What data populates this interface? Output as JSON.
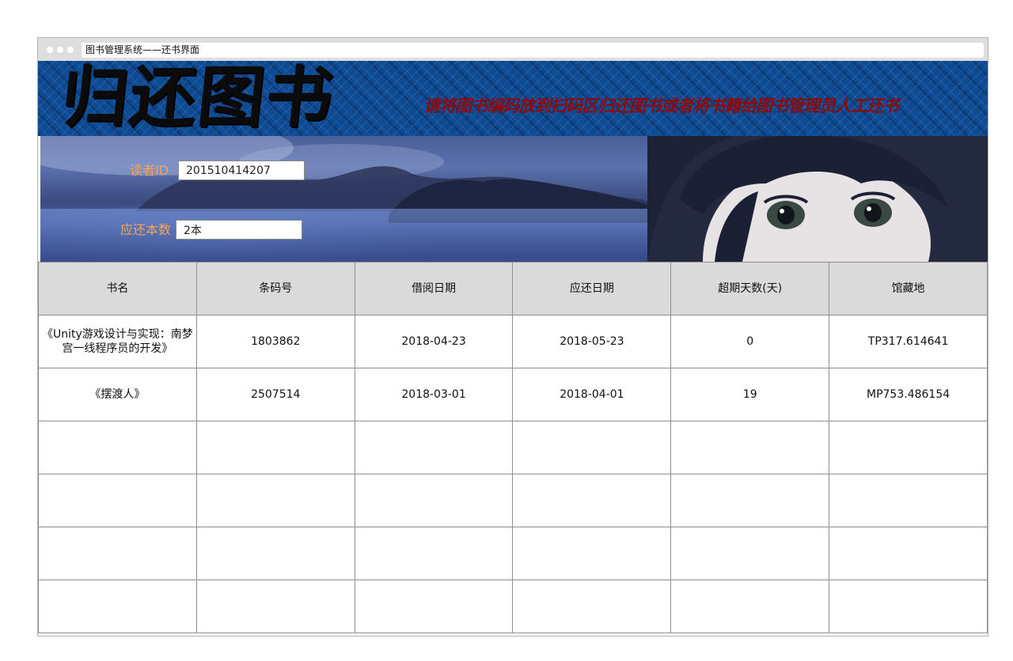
{
  "window": {
    "title": "图书管理系统——还书界面"
  },
  "banner": {
    "title": "归还图书",
    "subtitle": "请将图书编码放到扫码区归还图书或者将书籍给图书管理员人工还书"
  },
  "form": {
    "reader_id_label": "读者ID",
    "reader_id_value": "201510414207",
    "due_count_label": "应还本数",
    "due_count_value": "2本"
  },
  "table": {
    "headers": [
      "书名",
      "条码号",
      "借阅日期",
      "应还日期",
      "超期天数(天)",
      "馆藏地"
    ],
    "rows": [
      [
        "《Unity游戏设计与实现：南梦宫一线程序员的开发》",
        "1803862",
        "2018-04-23",
        "2018-05-23",
        "0",
        "TP317.614641"
      ],
      [
        "《摆渡人》",
        "2507514",
        "2018-03-01",
        "2018-04-01",
        "19",
        "MP753.486154"
      ],
      [
        "",
        "",
        "",
        "",
        "",
        ""
      ],
      [
        "",
        "",
        "",
        "",
        "",
        ""
      ],
      [
        "",
        "",
        "",
        "",
        "",
        ""
      ],
      [
        "",
        "",
        "",
        "",
        "",
        ""
      ]
    ]
  },
  "colors": {
    "banner_bg": "#0c4a93",
    "subtitle": "#8b0a0a",
    "form_label": "#f3a25c",
    "overdue": "#e25c4a",
    "header_bg": "#dadada"
  }
}
